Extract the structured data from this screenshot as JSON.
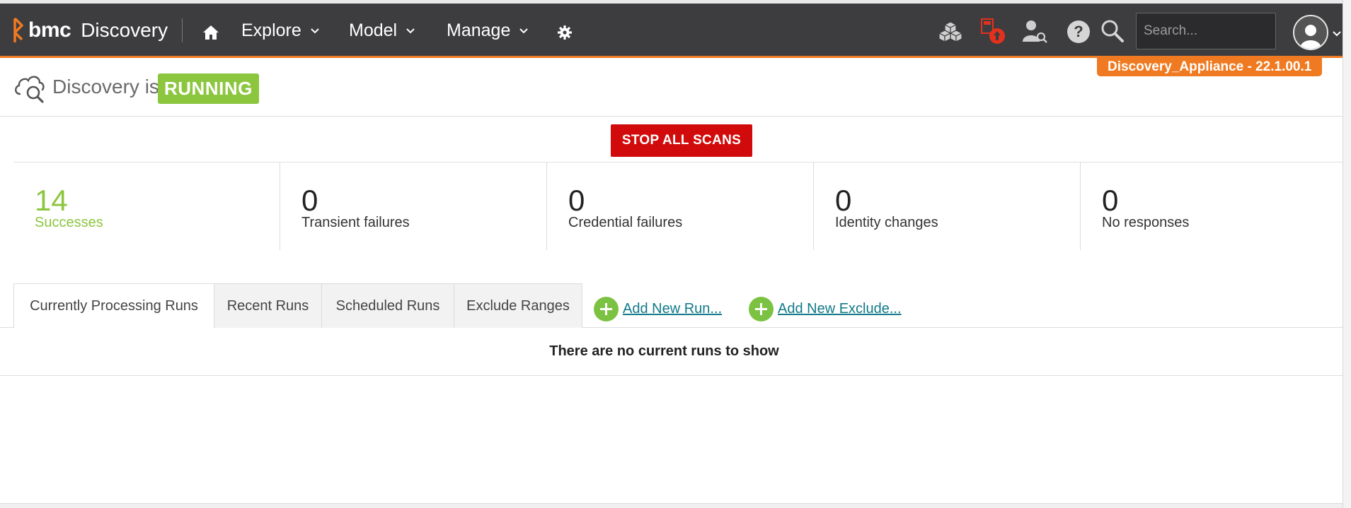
{
  "app": {
    "brand": "bmc",
    "product": "Discovery",
    "colors": {
      "nav_bg": "#3d3d3f",
      "accent": "#f07a21",
      "running": "#8cc63f",
      "stop": "#d10b0b",
      "link": "#11798a"
    }
  },
  "nav": {
    "items": [
      {
        "label": "Explore",
        "icon": "chevron-down-icon"
      },
      {
        "label": "Model",
        "icon": "chevron-down-icon"
      },
      {
        "label": "Manage",
        "icon": "chevron-down-icon"
      }
    ],
    "icons_left": [
      "home-icon",
      "gear-icon"
    ],
    "icons_right": [
      "cubes-icon",
      "notification-alert-icon",
      "user-search-icon",
      "help-icon",
      "search-icon"
    ],
    "search": {
      "placeholder": "Search...",
      "value": ""
    },
    "user": {
      "icon": "user-avatar-icon"
    }
  },
  "appliance": {
    "label": "Discovery_Appliance - 22.1.00.1"
  },
  "status": {
    "prefix": "Discovery is",
    "state": "RUNNING",
    "icon": "cloud-search-icon"
  },
  "actions": {
    "stop_all_scans": "STOP ALL SCANS"
  },
  "stats": [
    {
      "value": "14",
      "label": "Successes"
    },
    {
      "value": "0",
      "label": "Transient failures"
    },
    {
      "value": "0",
      "label": "Credential failures"
    },
    {
      "value": "0",
      "label": "Identity changes"
    },
    {
      "value": "0",
      "label": "No responses"
    }
  ],
  "tabs": [
    {
      "label": "Currently Processing Runs",
      "active": true
    },
    {
      "label": "Recent Runs",
      "active": false
    },
    {
      "label": "Scheduled Runs",
      "active": false
    },
    {
      "label": "Exclude Ranges",
      "active": false
    }
  ],
  "tab_actions": [
    {
      "label": "Add New Run...",
      "icon": "plus-circle-icon"
    },
    {
      "label": "Add New Exclude...",
      "icon": "plus-circle-icon"
    }
  ],
  "content": {
    "empty_message": "There are no current runs to show"
  }
}
